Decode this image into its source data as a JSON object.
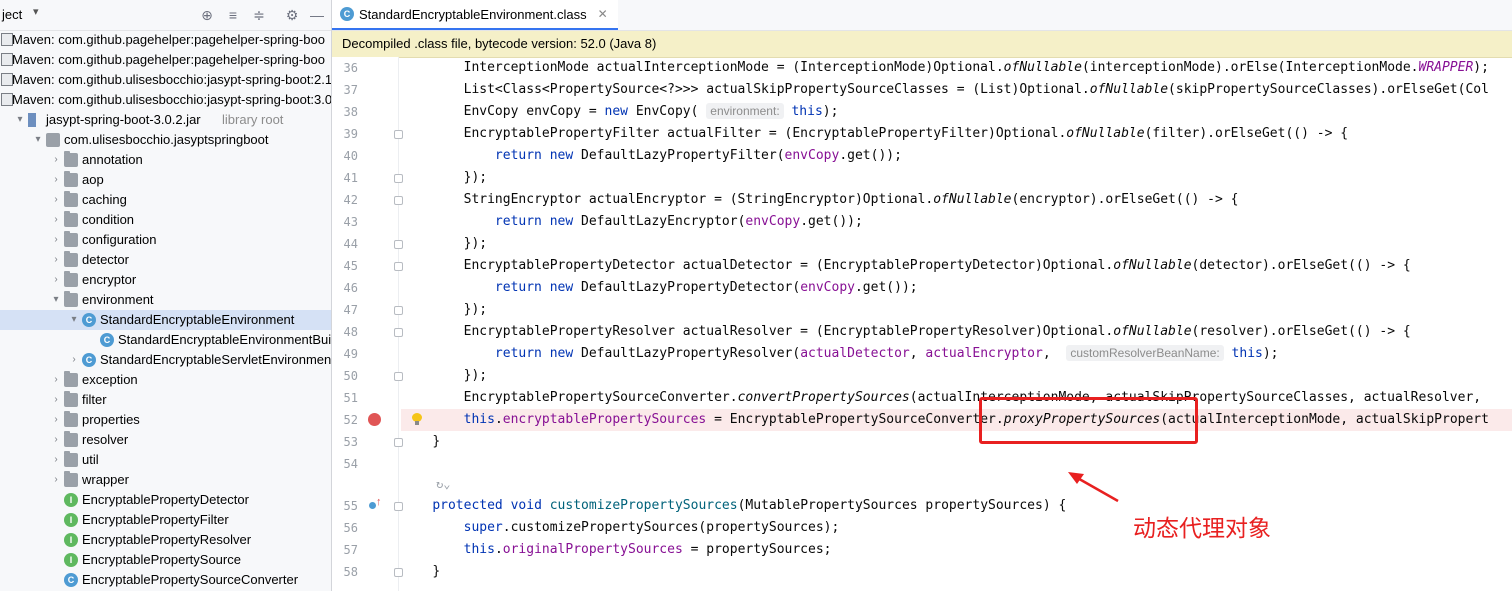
{
  "project_panel": {
    "title": "ject",
    "caret": "▾",
    "header_icons": [
      "crosshair-icon",
      "expand-all-icon",
      "collapse-all-icon",
      "gear-icon",
      "minus-icon"
    ],
    "tree": [
      {
        "label": "Maven: com.github.pagehelper:pagehelper-spring-boo",
        "icon": "library-icon",
        "indent": 0,
        "arrow": ""
      },
      {
        "label": "Maven: com.github.pagehelper:pagehelper-spring-boo",
        "icon": "library-icon",
        "indent": 0,
        "arrow": ""
      },
      {
        "label": "Maven: com.github.ulisesbocchio:jasypt-spring-boot:2.1",
        "icon": "library-icon",
        "indent": 0,
        "arrow": ""
      },
      {
        "label": "Maven: com.github.ulisesbocchio:jasypt-spring-boot:3.0",
        "icon": "library-icon",
        "indent": 0,
        "arrow": ""
      },
      {
        "label": "jasypt-spring-boot-3.0.2.jar",
        "suffix": "library root",
        "icon": "jar-icon",
        "indent": 1,
        "arrow": "▾"
      },
      {
        "label": "com.ulisesbocchio.jasyptspringboot",
        "icon": "package-icon",
        "indent": 2,
        "arrow": "▾"
      },
      {
        "label": "annotation",
        "icon": "folder-icon",
        "indent": 3,
        "arrow": "›"
      },
      {
        "label": "aop",
        "icon": "folder-icon",
        "indent": 3,
        "arrow": "›"
      },
      {
        "label": "caching",
        "icon": "folder-icon",
        "indent": 3,
        "arrow": "›"
      },
      {
        "label": "condition",
        "icon": "folder-icon",
        "indent": 3,
        "arrow": "›"
      },
      {
        "label": "configuration",
        "icon": "folder-icon",
        "indent": 3,
        "arrow": "›"
      },
      {
        "label": "detector",
        "icon": "folder-icon",
        "indent": 3,
        "arrow": "›"
      },
      {
        "label": "encryptor",
        "icon": "folder-icon",
        "indent": 3,
        "arrow": "›"
      },
      {
        "label": "environment",
        "icon": "folder-icon",
        "indent": 3,
        "arrow": "▾"
      },
      {
        "label": "StandardEncryptableEnvironment",
        "icon": "class-icon",
        "indent": 4,
        "arrow": "▾",
        "selected": true
      },
      {
        "label": "StandardEncryptableEnvironmentBuilder",
        "icon": "class-icon",
        "indent": 5,
        "arrow": ""
      },
      {
        "label": "StandardEncryptableServletEnvironment",
        "icon": "class-icon",
        "indent": 4,
        "arrow": "›"
      },
      {
        "label": "exception",
        "icon": "folder-icon",
        "indent": 3,
        "arrow": "›"
      },
      {
        "label": "filter",
        "icon": "folder-icon",
        "indent": 3,
        "arrow": "›"
      },
      {
        "label": "properties",
        "icon": "folder-icon",
        "indent": 3,
        "arrow": "›"
      },
      {
        "label": "resolver",
        "icon": "folder-icon",
        "indent": 3,
        "arrow": "›"
      },
      {
        "label": "util",
        "icon": "folder-icon",
        "indent": 3,
        "arrow": "›"
      },
      {
        "label": "wrapper",
        "icon": "folder-icon",
        "indent": 3,
        "arrow": "›"
      },
      {
        "label": "EncryptablePropertyDetector",
        "icon": "interface-icon",
        "indent": 3,
        "arrow": ""
      },
      {
        "label": "EncryptablePropertyFilter",
        "icon": "interface-icon",
        "indent": 3,
        "arrow": ""
      },
      {
        "label": "EncryptablePropertyResolver",
        "icon": "interface-icon",
        "indent": 3,
        "arrow": ""
      },
      {
        "label": "EncryptablePropertySource",
        "icon": "interface-icon",
        "indent": 3,
        "arrow": ""
      },
      {
        "label": "EncryptablePropertySourceConverter",
        "icon": "class-icon",
        "indent": 3,
        "arrow": ""
      }
    ]
  },
  "editor": {
    "tab_label": "StandardEncryptableEnvironment.class",
    "tab_close": "✕",
    "banner": "Decompiled .class file, bytecode version: 52.0 (Java 8)",
    "lines": [
      {
        "n": "36",
        "indent": 2,
        "segs": [
          [
            "InterceptionMode actualInterceptionMode = (InterceptionMode)Optional.",
            ""
          ],
          [
            "ofNullable",
            "it"
          ],
          [
            "(interceptionMode).orElse(InterceptionMode.",
            ""
          ],
          [
            "WRAPPER",
            "itf"
          ],
          [
            ");",
            ""
          ]
        ]
      },
      {
        "n": "37",
        "indent": 2,
        "segs": [
          [
            "List<Class<PropertySource<?>>> actualSkipPropertySourceClasses = (List)Optional.",
            ""
          ],
          [
            "ofNullable",
            "it"
          ],
          [
            "(skipPropertySourceClasses).orElseGet(Col",
            ""
          ]
        ]
      },
      {
        "n": "38",
        "indent": 2,
        "segs": [
          [
            "EnvCopy envCopy = ",
            ""
          ],
          [
            "new",
            "kw"
          ],
          [
            " EnvCopy( ",
            ""
          ],
          [
            "environment:",
            "hint"
          ],
          [
            " ",
            ""
          ],
          [
            "this",
            "kw"
          ],
          [
            ");",
            ""
          ]
        ]
      },
      {
        "n": "39",
        "indent": 2,
        "fold": true,
        "segs": [
          [
            "EncryptablePropertyFilter actualFilter = (EncryptablePropertyFilter)Optional.",
            ""
          ],
          [
            "ofNullable",
            "it"
          ],
          [
            "(filter).orElseGet(() -> {",
            ""
          ]
        ]
      },
      {
        "n": "40",
        "indent": 3,
        "segs": [
          [
            "return",
            "kw"
          ],
          [
            " ",
            ""
          ],
          [
            "new",
            "kw"
          ],
          [
            " DefaultLazyPropertyFilter(",
            ""
          ],
          [
            "envCopy",
            "fld"
          ],
          [
            ".get());",
            ""
          ]
        ]
      },
      {
        "n": "41",
        "indent": 2,
        "fold": true,
        "segs": [
          [
            "});",
            ""
          ]
        ]
      },
      {
        "n": "42",
        "indent": 2,
        "fold": true,
        "segs": [
          [
            "StringEncryptor actualEncryptor = (StringEncryptor)Optional.",
            ""
          ],
          [
            "ofNullable",
            "it"
          ],
          [
            "(encryptor).orElseGet(() -> {",
            ""
          ]
        ]
      },
      {
        "n": "43",
        "indent": 3,
        "segs": [
          [
            "return",
            "kw"
          ],
          [
            " ",
            ""
          ],
          [
            "new",
            "kw"
          ],
          [
            " DefaultLazyEncryptor(",
            ""
          ],
          [
            "envCopy",
            "fld"
          ],
          [
            ".get());",
            ""
          ]
        ]
      },
      {
        "n": "44",
        "indent": 2,
        "fold": true,
        "segs": [
          [
            "});",
            ""
          ]
        ]
      },
      {
        "n": "45",
        "indent": 2,
        "fold": true,
        "segs": [
          [
            "EncryptablePropertyDetector actualDetector = (EncryptablePropertyDetector)Optional.",
            ""
          ],
          [
            "ofNullable",
            "it"
          ],
          [
            "(detector).orElseGet(() -> {",
            ""
          ]
        ]
      },
      {
        "n": "46",
        "indent": 3,
        "segs": [
          [
            "return",
            "kw"
          ],
          [
            " ",
            ""
          ],
          [
            "new",
            "kw"
          ],
          [
            " DefaultLazyPropertyDetector(",
            ""
          ],
          [
            "envCopy",
            "fld"
          ],
          [
            ".get());",
            ""
          ]
        ]
      },
      {
        "n": "47",
        "indent": 2,
        "fold": true,
        "segs": [
          [
            "});",
            ""
          ]
        ]
      },
      {
        "n": "48",
        "indent": 2,
        "fold": true,
        "segs": [
          [
            "EncryptablePropertyResolver actualResolver = (EncryptablePropertyResolver)Optional.",
            ""
          ],
          [
            "ofNullable",
            "it"
          ],
          [
            "(resolver).orElseGet(() -> {",
            ""
          ]
        ]
      },
      {
        "n": "49",
        "indent": 3,
        "segs": [
          [
            "return",
            "kw"
          ],
          [
            " ",
            ""
          ],
          [
            "new",
            "kw"
          ],
          [
            " DefaultLazyPropertyResolver(",
            ""
          ],
          [
            "actualDetector",
            "fld"
          ],
          [
            ", ",
            ""
          ],
          [
            "actualEncryptor",
            "fld"
          ],
          [
            ",  ",
            ""
          ],
          [
            "customResolverBeanName:",
            "hint"
          ],
          [
            " ",
            ""
          ],
          [
            "this",
            "kw"
          ],
          [
            ");",
            ""
          ]
        ]
      },
      {
        "n": "50",
        "indent": 2,
        "fold": true,
        "segs": [
          [
            "});",
            ""
          ]
        ]
      },
      {
        "n": "51",
        "indent": 2,
        "segs": [
          [
            "EncryptablePropertySourceConverter.",
            ""
          ],
          [
            "convertPropertySources",
            "it"
          ],
          [
            "(actualInterceptionMode, actualSkipPropertySourceClasses, actualResolver, ",
            ""
          ]
        ]
      },
      {
        "n": "52",
        "indent": 2,
        "highlight": true,
        "breakpoint": true,
        "bulb": true,
        "segs": [
          [
            "this",
            "kw"
          ],
          [
            ".",
            ""
          ],
          [
            "encryptablePropertySources",
            "fld"
          ],
          [
            " = EncryptablePropertySourceConverter.",
            ""
          ],
          [
            "proxyPropertySources",
            "it"
          ],
          [
            "(actualInterceptionMode, actualSkipPropert",
            ""
          ]
        ]
      },
      {
        "n": "53",
        "indent": 1,
        "fold": true,
        "segs": [
          [
            "}",
            ""
          ]
        ]
      },
      {
        "n": "54",
        "indent": 0,
        "segs": [
          [
            "",
            ""
          ]
        ]
      },
      {
        "n": "",
        "indent": 0,
        "usage": "↻⌄",
        "segs": [
          [
            "",
            ""
          ]
        ]
      },
      {
        "n": "55",
        "indent": 1,
        "fold": true,
        "override": true,
        "segs": [
          [
            "protected",
            "kw"
          ],
          [
            " ",
            ""
          ],
          [
            "void",
            "kw"
          ],
          [
            " ",
            ""
          ],
          [
            "customizePropertySources",
            "fn"
          ],
          [
            "(MutablePropertySources propertySources) {",
            ""
          ]
        ]
      },
      {
        "n": "56",
        "indent": 2,
        "segs": [
          [
            "super",
            "kw"
          ],
          [
            ".customizePropertySources(propertySources);",
            ""
          ]
        ]
      },
      {
        "n": "57",
        "indent": 2,
        "segs": [
          [
            "this",
            "kw"
          ],
          [
            ".",
            ""
          ],
          [
            "originalPropertySources",
            "fld"
          ],
          [
            " = propertySources;",
            ""
          ]
        ]
      },
      {
        "n": "58",
        "indent": 1,
        "fold": true,
        "segs": [
          [
            "}",
            ""
          ]
        ]
      }
    ]
  },
  "annotation": {
    "text": "动态代理对象",
    "color": "#e82020"
  }
}
